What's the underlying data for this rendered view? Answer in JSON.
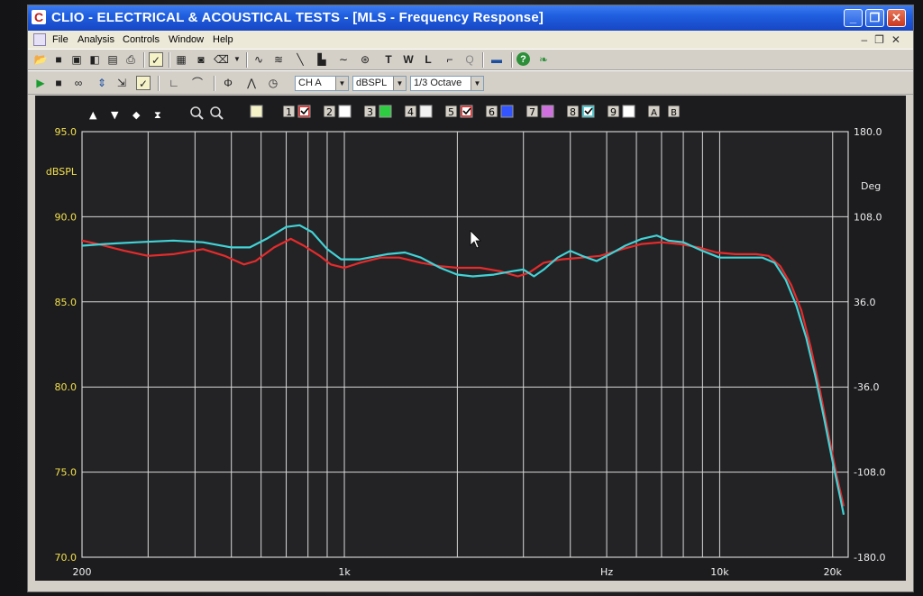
{
  "window": {
    "title": "CLIO - ELECTRICAL & ACOUSTICAL TESTS - [MLS - Frequency Response]",
    "app_icon": "C",
    "minimize_label": "_",
    "maximize_label": "❐",
    "close_label": "✕"
  },
  "menu": {
    "items": [
      "File",
      "Analysis",
      "Controls",
      "Window",
      "Help"
    ]
  },
  "toolbar2": {
    "channel": "CH A",
    "unit": "dBSPL",
    "smoothing": "1/3 Octave"
  },
  "overlays": {
    "labels": [
      "1",
      "2",
      "3",
      "4",
      "5",
      "6",
      "7",
      "8",
      "9"
    ],
    "colors": [
      "#e03030",
      "#ffffff",
      "#2ecc40",
      "#f2f2f2",
      "#e03030",
      "#3355ff",
      "#d070e0",
      "#3fd0d8",
      "#ffffff"
    ],
    "checked": [
      true,
      false,
      false,
      false,
      true,
      false,
      false,
      true,
      false
    ],
    "marker_a": "A",
    "marker_b": "B"
  },
  "chart_data": {
    "type": "line",
    "x_scale": "log",
    "xlim": [
      200,
      22000
    ],
    "ylim": [
      70,
      95
    ],
    "y2lim": [
      -180,
      180
    ],
    "ylabel": "dBSPL",
    "y2label": "Deg",
    "xlabel": "Hz",
    "y_ticks": [
      "95.0",
      "90.0",
      "85.0",
      "80.0",
      "75.0",
      "70.0"
    ],
    "y2_ticks": [
      "180.0",
      "108.0",
      "36.0",
      "-36.0",
      "-108.0",
      "-180.0"
    ],
    "x_tick_labels": [
      {
        "freq": 200,
        "label": "200"
      },
      {
        "freq": 1000,
        "label": "1k"
      },
      {
        "freq": 5000,
        "label": "Hz"
      },
      {
        "freq": 10000,
        "label": "10k"
      },
      {
        "freq": 20000,
        "label": "20k"
      }
    ],
    "grid": true,
    "series": [
      {
        "color": "#e62b2b",
        "points": [
          [
            200,
            88.6
          ],
          [
            220,
            88.4
          ],
          [
            260,
            88.0
          ],
          [
            300,
            87.7
          ],
          [
            350,
            87.8
          ],
          [
            420,
            88.1
          ],
          [
            480,
            87.7
          ],
          [
            540,
            87.2
          ],
          [
            580,
            87.4
          ],
          [
            650,
            88.2
          ],
          [
            720,
            88.7
          ],
          [
            780,
            88.3
          ],
          [
            860,
            87.7
          ],
          [
            920,
            87.2
          ],
          [
            1000,
            87.0
          ],
          [
            1100,
            87.3
          ],
          [
            1250,
            87.6
          ],
          [
            1400,
            87.6
          ],
          [
            1600,
            87.3
          ],
          [
            1800,
            87.1
          ],
          [
            2000,
            87.0
          ],
          [
            2300,
            87.0
          ],
          [
            2600,
            86.8
          ],
          [
            2900,
            86.5
          ],
          [
            3100,
            86.7
          ],
          [
            3400,
            87.3
          ],
          [
            3800,
            87.5
          ],
          [
            4300,
            87.6
          ],
          [
            4800,
            87.7
          ],
          [
            5500,
            88.1
          ],
          [
            6200,
            88.4
          ],
          [
            7000,
            88.5
          ],
          [
            7800,
            88.4
          ],
          [
            8800,
            88.2
          ],
          [
            9800,
            87.9
          ],
          [
            11000,
            87.8
          ],
          [
            12500,
            87.8
          ],
          [
            13500,
            87.7
          ],
          [
            14500,
            87.1
          ],
          [
            15500,
            86.0
          ],
          [
            16500,
            84.5
          ],
          [
            17500,
            82.3
          ],
          [
            18500,
            79.8
          ],
          [
            19500,
            77.2
          ],
          [
            20500,
            74.8
          ],
          [
            21400,
            73.0
          ]
        ]
      },
      {
        "color": "#41d3d6",
        "points": [
          [
            200,
            88.3
          ],
          [
            230,
            88.4
          ],
          [
            280,
            88.5
          ],
          [
            350,
            88.6
          ],
          [
            420,
            88.5
          ],
          [
            500,
            88.2
          ],
          [
            560,
            88.2
          ],
          [
            620,
            88.7
          ],
          [
            700,
            89.4
          ],
          [
            760,
            89.5
          ],
          [
            820,
            89.1
          ],
          [
            900,
            88.1
          ],
          [
            980,
            87.5
          ],
          [
            1100,
            87.5
          ],
          [
            1300,
            87.8
          ],
          [
            1450,
            87.9
          ],
          [
            1600,
            87.6
          ],
          [
            1800,
            87.0
          ],
          [
            2000,
            86.6
          ],
          [
            2200,
            86.5
          ],
          [
            2500,
            86.6
          ],
          [
            2800,
            86.8
          ],
          [
            3000,
            86.9
          ],
          [
            3200,
            86.5
          ],
          [
            3400,
            86.9
          ],
          [
            3700,
            87.6
          ],
          [
            4000,
            88.0
          ],
          [
            4300,
            87.7
          ],
          [
            4700,
            87.4
          ],
          [
            5100,
            87.8
          ],
          [
            5600,
            88.3
          ],
          [
            6200,
            88.7
          ],
          [
            6800,
            88.9
          ],
          [
            7300,
            88.6
          ],
          [
            8000,
            88.5
          ],
          [
            9000,
            88.0
          ],
          [
            10000,
            87.6
          ],
          [
            11500,
            87.6
          ],
          [
            13000,
            87.6
          ],
          [
            14000,
            87.3
          ],
          [
            15000,
            86.3
          ],
          [
            16000,
            84.8
          ],
          [
            17000,
            82.9
          ],
          [
            18000,
            80.6
          ],
          [
            19000,
            78.1
          ],
          [
            20000,
            75.6
          ],
          [
            21000,
            73.4
          ],
          [
            21400,
            72.5
          ]
        ]
      }
    ]
  },
  "status": {
    "text": ""
  }
}
